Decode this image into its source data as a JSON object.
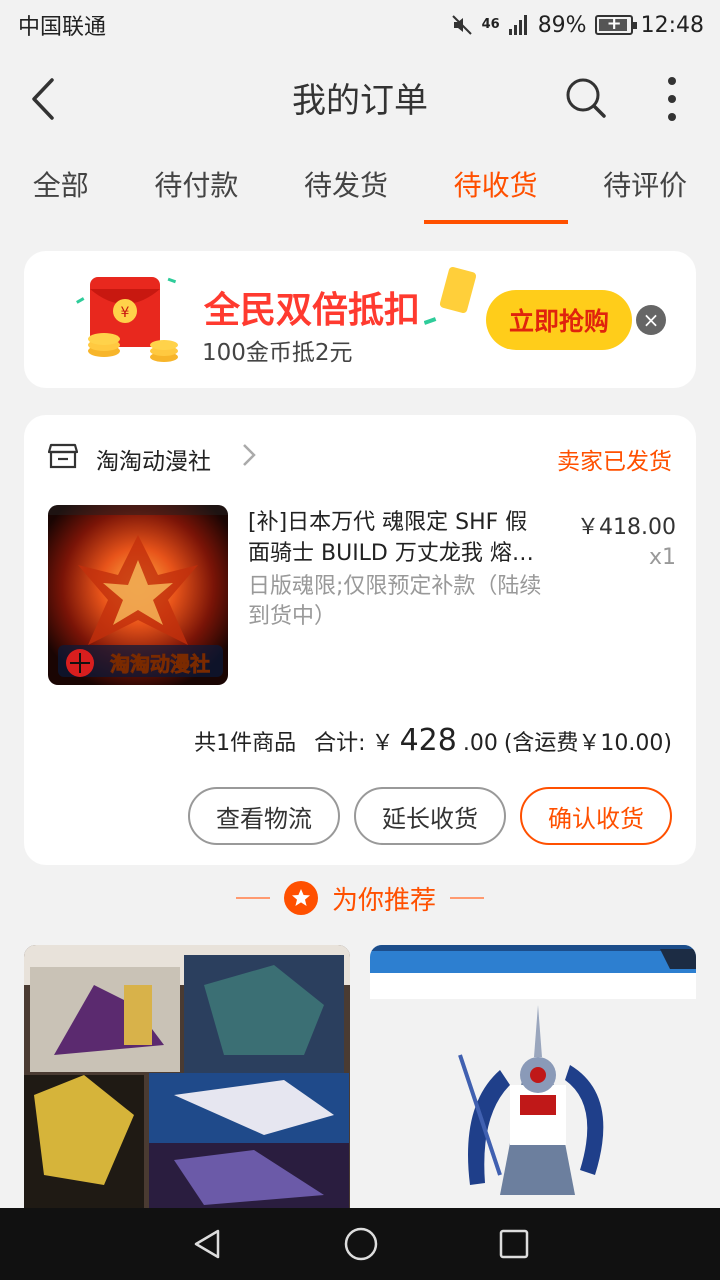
{
  "status_bar": {
    "carrier": "中国联通",
    "signal": "46",
    "battery": "89%",
    "time": "12:48"
  },
  "header": {
    "title": "我的订单"
  },
  "tabs": [
    {
      "label": "全部",
      "active": false
    },
    {
      "label": "待付款",
      "active": false
    },
    {
      "label": "待发货",
      "active": false
    },
    {
      "label": "待收货",
      "active": true
    },
    {
      "label": "待评价",
      "active": false
    }
  ],
  "promo": {
    "title": "全民双倍抵扣",
    "subtitle": "100金币抵2元",
    "cta": "立即抢购",
    "close": "×"
  },
  "order": {
    "shop_name": "淘淘动漫社",
    "status": "卖家已发货",
    "product": {
      "title": "[补]日本万代 魂限定 SHF 假面骑士 BUILD 万丈龙我 熔…",
      "sku": "日版魂限;仅限预定补款（陆续到货中）",
      "price": "￥418.00",
      "qty": "x1",
      "thumb_caption": "淘淘动漫社"
    },
    "summary": {
      "count": "共1件商品",
      "total_label": "合计:",
      "currency": "￥",
      "total_int": "428",
      "total_dec": ".00",
      "shipping": "(含运费￥10.00)"
    },
    "buttons": {
      "logistics": "查看物流",
      "extend": "延长收货",
      "confirm": "确认收货"
    }
  },
  "recommend": {
    "title": "为你推荐"
  },
  "colors": {
    "accent": "#ff5000",
    "promo_red": "#ff3a2f",
    "cta_yellow": "#ffcd1a"
  }
}
